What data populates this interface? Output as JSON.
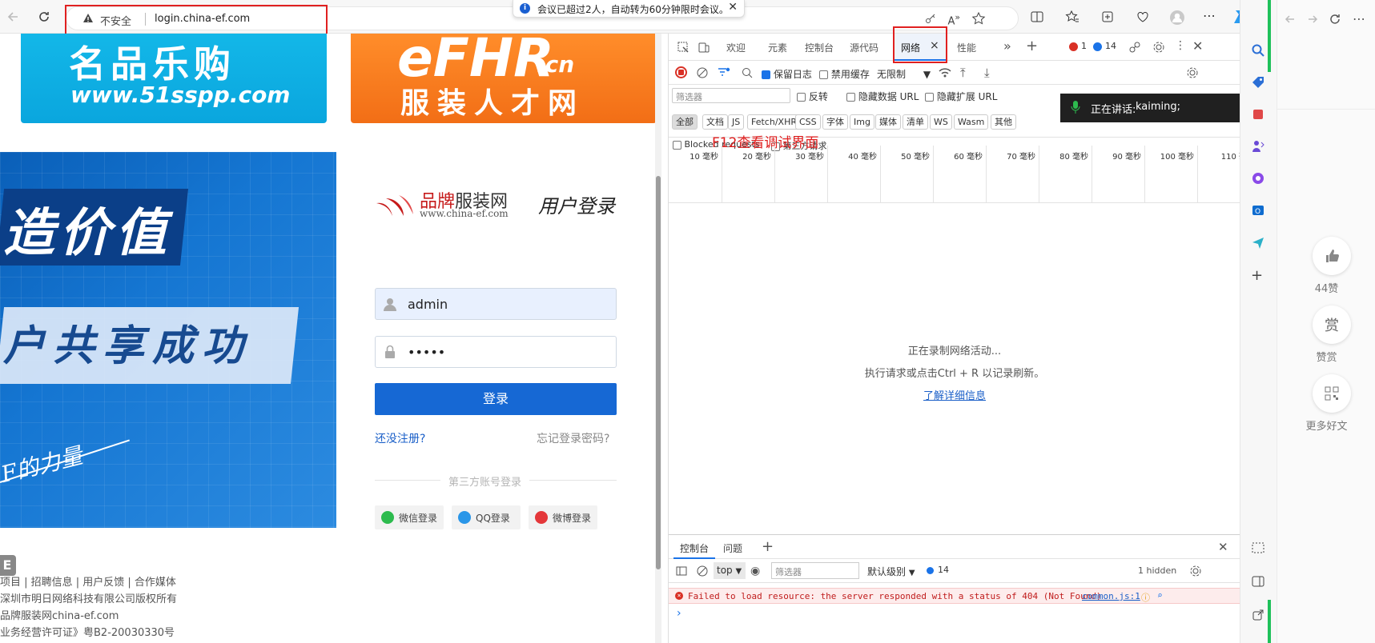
{
  "browser": {
    "address": {
      "security": "不安全",
      "url": "login.china-ef.com"
    },
    "notification": "会议已超过2人，自动转为60分钟限时会议。"
  },
  "page": {
    "banner1": {
      "title": "名品乐购",
      "url": "www.51sspp.com"
    },
    "banner2": {
      "title": "eFHR",
      "suffix": ".cn",
      "subtitle": "服装人才网"
    },
    "hero": {
      "line1": "造价值",
      "line2": "户共享成功",
      "line3": "F的力量"
    },
    "login": {
      "brand_red": "品牌",
      "brand_black": "服装网",
      "site": "www.china-ef.com",
      "title": "用户登录",
      "username": "admin",
      "password_mask": "•••••",
      "submit": "登录",
      "register": "还没注册?",
      "forgot": "忘记登录密码?",
      "third_party": "第三方账号登录",
      "wechat": "微信登录",
      "qq": "QQ登录",
      "weibo": "微博登录"
    },
    "footer": {
      "badge": "E",
      "links": "项目 | 招聘信息 | 用户反馈 | 合作媒体",
      "copyright": "深圳市明日网络科技有限公司版权所有",
      "site": "品牌服装网china-ef.com",
      "license": "业务经营许可证》粤B2-20030330号"
    }
  },
  "devtools": {
    "tabs": [
      "欢迎",
      "元素",
      "控制台",
      "源代码",
      "网络",
      "性能"
    ],
    "active_tab_close": "×",
    "error_count": "1",
    "message_count": "14",
    "toolbar": {
      "preserve_log": "保留日志",
      "disable_cache": "禁用缓存",
      "throttle": "无限制"
    },
    "filter": {
      "placeholder": "筛选器",
      "invert": "反转",
      "hide_data_url": "隐藏数据 URL",
      "hide_ext_url": "隐藏扩展 URL",
      "types": [
        "全部",
        "文档",
        "JS",
        "Fetch/XHR",
        "CSS",
        "字体",
        "Img",
        "媒体",
        "清单",
        "WS",
        "Wasm",
        "其他"
      ],
      "blocked_requests": "Blocked requests",
      "third_party_requests": "第三方请求"
    },
    "annotation": "F12查看调试界面",
    "timeline_ticks": [
      "10 毫秒",
      "20 毫秒",
      "30 毫秒",
      "40 毫秒",
      "50 毫秒",
      "60 毫秒",
      "70 毫秒",
      "80 毫秒",
      "90 毫秒",
      "100 毫秒",
      "110 毫"
    ],
    "recording": {
      "line1": "正在录制网络活动...",
      "line2": "执行请求或点击Ctrl + R 以记录刷新。",
      "link": "了解详细信息"
    },
    "drawer": {
      "tabs": [
        "控制台",
        "问题"
      ],
      "context": "top",
      "filter_placeholder": "筛选器",
      "level": "默认级别",
      "msg_count": "14",
      "hidden": "1 hidden",
      "error_text": "Failed to load resource: the server responded with a status of 404 (Not Found)",
      "error_source": "common.js:1",
      "prompt": "›"
    }
  },
  "toast": {
    "label": "正在讲话:",
    "speaker": "kaiming;"
  },
  "right_panel": {
    "like_count": "44赞",
    "reward_icon_text": "赏",
    "reward": "赞赏",
    "more": "更多好文"
  },
  "colors": {
    "accent": "#1668d4",
    "error": "#c01c1c",
    "annotation": "#e02020",
    "edge_green": "#1ec15a"
  }
}
